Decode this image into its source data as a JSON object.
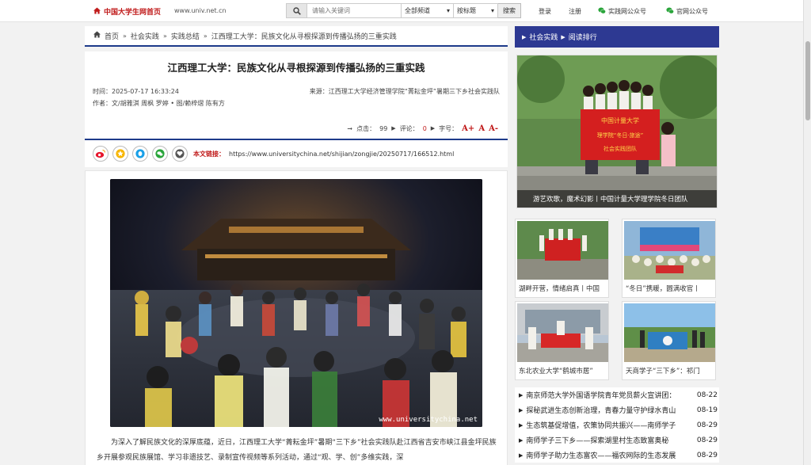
{
  "topbar": {
    "logo_text": "中国大学生网首页",
    "domain": "www.univ.net.cn",
    "search_placeholder": "请输入关键词",
    "channel_select": "全部频道",
    "sort_select": "按标题",
    "search_button": "搜索",
    "login": "登录",
    "register": "注册",
    "wechat_practice": "实践网公众号",
    "wechat_official": "官网公众号"
  },
  "breadcrumb": {
    "home": "首页",
    "level1": "社会实践",
    "level2": "实践总结",
    "current": "江西理工大学：民族文化从寻根探源到传播弘扬的三重实践"
  },
  "article": {
    "title": "江西理工大学：民族文化从寻根探源到传播弘扬的三重实践",
    "time": "时间：2025-07-17 16:33:24",
    "source": "来源：江西理工大学经济管理学院“菁耘金坪”暑期三下乡社会实践队",
    "author": "作者：文/胡雅淇 周枫 罗婷 • 图/赖梓熠 陈有方",
    "clicks_label": "点击：",
    "clicks": "99",
    "comments_label": "评论：",
    "comments": "0",
    "fontsize_label": "字号：",
    "font_a_plus": "A+",
    "font_a": "A",
    "font_a_minus": "A-",
    "link_label": "本文链接：",
    "link": "https://www.universitychina.net/shijian/zongjie/20250717/166512.html",
    "watermark": "www.universitychina.net",
    "paragraph": "为深入了解民族文化的深厚底蕴，近日，江西理工大学“菁耘金坪”暑期“三下乡”社会实践队赴江西省吉安市峡江县金坪民族乡开展参观民族展馆、学习非遗技艺、录制宣传视频等系列活动，通过“观、学、创”多维实践，深"
  },
  "sidebar": {
    "header_a": "社会实践",
    "header_b": "阅读排行",
    "big_caption": "游艺欢歌，魔术幻影丨中国计量大学理学院冬日团队",
    "banner_text_1": "中国计量大学",
    "banner_text_2": "理学院“冬日·旅途”",
    "banner_text_3": "社会实践团队",
    "thumbs": [
      {
        "caption": "湖畔开营，情绪启真丨中国"
      },
      {
        "caption": "“冬日”携暖，圆满收官丨"
      },
      {
        "caption": "东北农业大学“鹤城市居”"
      },
      {
        "caption": "天商学子“三下乡”：祁门"
      }
    ],
    "news": [
      {
        "title": "南京师范大学外国语学院青年党员薪火宣讲团：",
        "date": "08-22"
      },
      {
        "title": "探秘武进生态创新治理，青春力量守护绿水青山",
        "date": "08-19"
      },
      {
        "title": "生态筑基促增值，农策协同共振兴——南师学子",
        "date": "08-29"
      },
      {
        "title": "南师学子三下乡——探索湖里村生态致富奥秘",
        "date": "08-29"
      },
      {
        "title": "南师学子助力生态富农——福农网际的生态发展",
        "date": "08-29"
      }
    ]
  },
  "colors": {
    "accent_red": "#c01a1a",
    "nav_blue": "#2d3992",
    "border_blue": "#1d3a8a"
  }
}
